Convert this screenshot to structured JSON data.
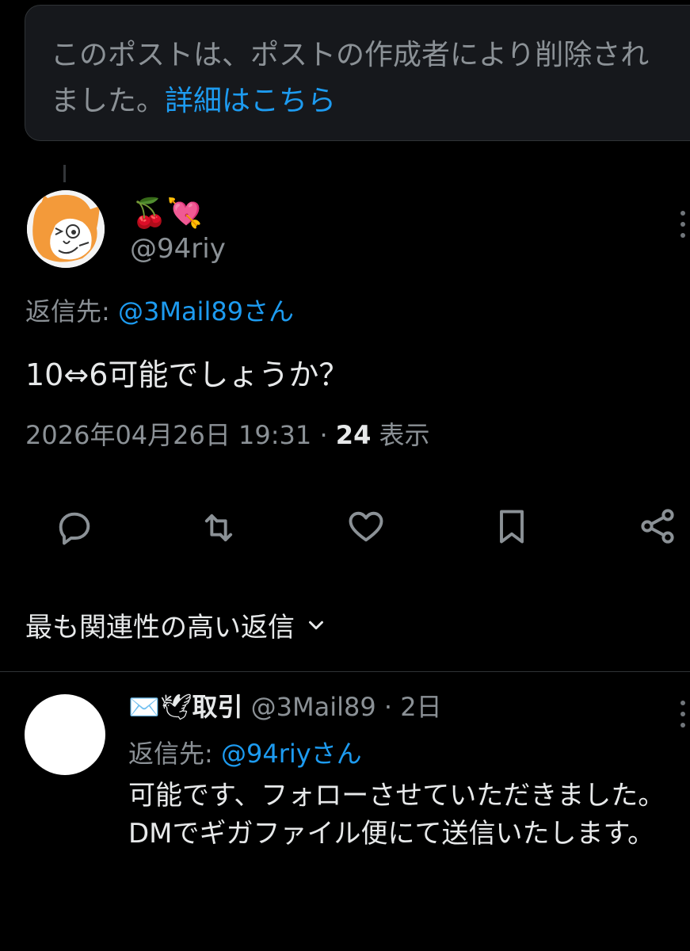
{
  "deleted_notice": {
    "text": "このポストは、ポストの作成者により削除されました。",
    "link": "詳細はこちら"
  },
  "post": {
    "display_name_emojis": "🍒💘",
    "handle": "@94riy",
    "reply_label": "返信先: ",
    "reply_target": "@3Mail89さん",
    "text": "10⇔6可能でしょうか？",
    "timestamp": "2026年04月26日 19:31",
    "separator": " · ",
    "view_count": "24",
    "view_label": " 表示",
    "actions": [
      "reply-icon",
      "repost-icon",
      "like-icon",
      "bookmark-icon",
      "share-icon"
    ]
  },
  "sort": {
    "label": "最も関連性の高い返信"
  },
  "reply": {
    "display_name_emojis": "✉️🕊",
    "display_name": "取引",
    "handle": "@3Mail89",
    "time": " · 2日",
    "reply_label": "返信先: ",
    "reply_target": "@94riyさん",
    "body": "可能です、フォローさせていただきました。\nDMでギガファイル便にて送信いたします。"
  },
  "colors": {
    "background": "#000000",
    "link": "#1d9bf0",
    "muted": "#8b9196",
    "text": "#e7e9ea"
  }
}
